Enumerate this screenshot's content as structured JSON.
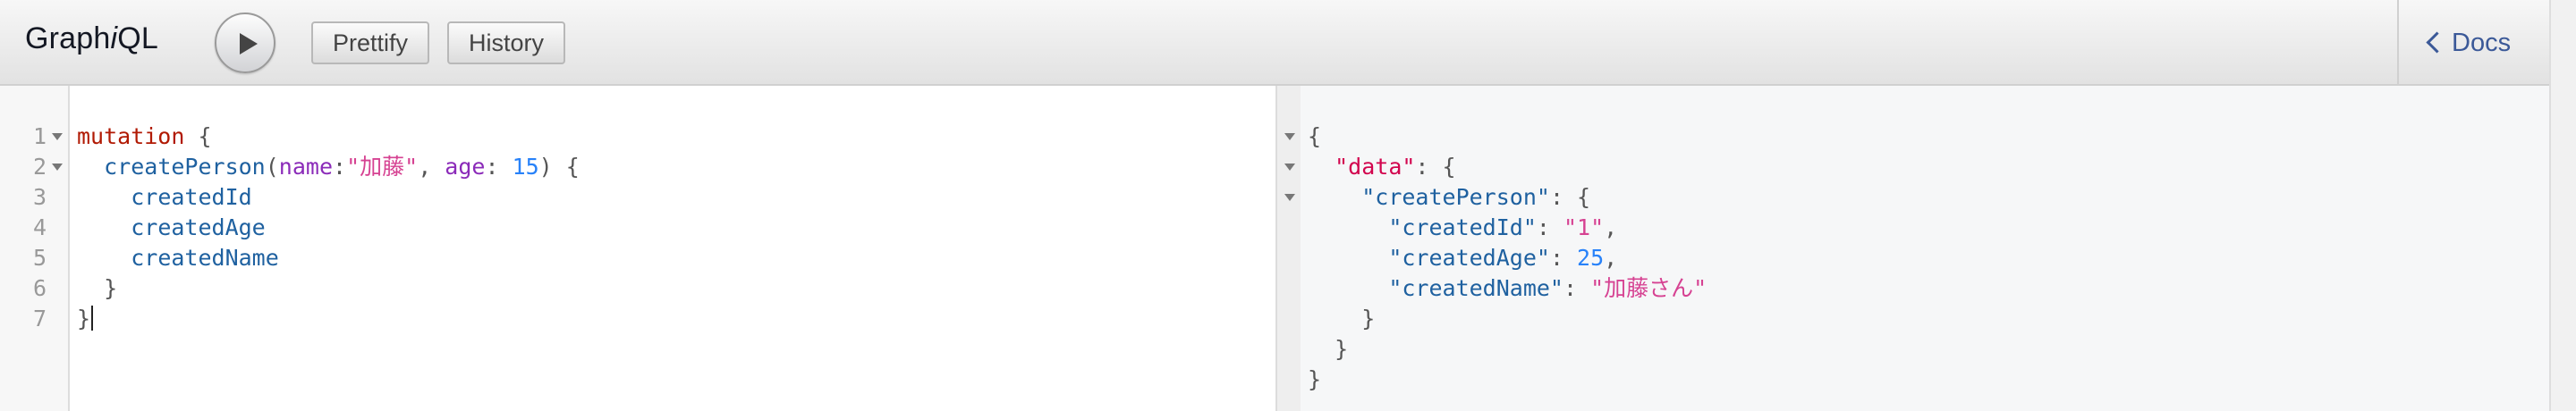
{
  "app": {
    "title_prefix": "Graph",
    "title_italic": "i",
    "title_suffix": "QL"
  },
  "toolbar": {
    "run_icon": "play-icon",
    "prettify_label": "Prettify",
    "history_label": "History",
    "docs_label": "Docs",
    "docs_icon": "chevron-left-icon"
  },
  "query_editor": {
    "line_numbers": [
      "1",
      "2",
      "3",
      "4",
      "5",
      "6",
      "7"
    ],
    "l1": {
      "keyword": "mutation",
      "brace": " {"
    },
    "l2": {
      "indent": "  ",
      "field": "createPerson",
      "open": "(",
      "arg1_name": "name",
      "arg1_sep": ":",
      "arg1_value": "\"加藤\"",
      "comma": ", ",
      "arg2_name": "age",
      "arg2_sep": ": ",
      "arg2_value": "15",
      "close": ") {"
    },
    "l3": {
      "indent": "    ",
      "field": "createdId"
    },
    "l4": {
      "indent": "    ",
      "field": "createdAge"
    },
    "l5": {
      "indent": "    ",
      "field": "createdName"
    },
    "l6": {
      "text": "  }"
    },
    "l7": {
      "text": "}"
    }
  },
  "result": {
    "r1": "{",
    "r2": {
      "indent": "  ",
      "key": "\"data\"",
      "rest": ": {"
    },
    "r3": {
      "indent": "    ",
      "key": "\"createPerson\"",
      "rest": ": {"
    },
    "r4": {
      "indent": "      ",
      "key": "\"createdId\"",
      "sep": ": ",
      "value": "\"1\"",
      "tail": ","
    },
    "r5": {
      "indent": "      ",
      "key": "\"createdAge\"",
      "sep": ": ",
      "value": "25",
      "tail": ","
    },
    "r6": {
      "indent": "      ",
      "key": "\"createdName\"",
      "sep": ": ",
      "value": "\"加藤さん\"",
      "tail": ""
    },
    "r7": "    }",
    "r8": "  }",
    "r9": "}"
  },
  "colors": {
    "keyword": "#b11a04",
    "field": "#1f61a0",
    "argument": "#8b2bb9",
    "string": "#d64292",
    "number": "#2882f9",
    "docs_link": "#3b5998"
  }
}
